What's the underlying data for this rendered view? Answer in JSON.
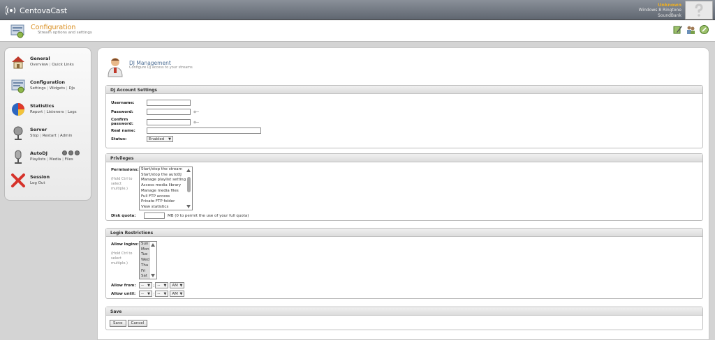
{
  "app": {
    "name": "CentovaCast"
  },
  "user": {
    "name": "Unknown",
    "os": "Windows 8 Ringtone",
    "server": "SoundBank"
  },
  "header": {
    "title": "Configuration",
    "subtitle": "Stream options and settings"
  },
  "sidebar": {
    "sections": [
      {
        "title": "General",
        "links": [
          "Overview",
          "Quick Links"
        ]
      },
      {
        "title": "Configuration",
        "links": [
          "Settings",
          "Widgets",
          "DJs"
        ]
      },
      {
        "title": "Statistics",
        "links": [
          "Report",
          "Listeners",
          "Logs"
        ]
      },
      {
        "title": "Server",
        "links": [
          "Stop",
          "Restart",
          "Admin"
        ]
      },
      {
        "title": "AutoDJ",
        "links": [
          "Playlists",
          "Media",
          "Files"
        ]
      },
      {
        "title": "Session",
        "links": [
          "Log Out"
        ]
      }
    ]
  },
  "page": {
    "title": "DJ Management",
    "subtitle": "Configure DJ access to your streams"
  },
  "account": {
    "legend": "DJ Account Settings",
    "username_label": "Username:",
    "password_label": "Password:",
    "confirm_label": "Confirm password:",
    "realname_label": "Real name:",
    "status_label": "Status:",
    "status_value": "Enabled"
  },
  "privileges": {
    "legend": "Privileges",
    "permissions_label": "Permissions:",
    "hint": "(Hold Ctrl to select multiple.)",
    "options": [
      "Start/stop the stream",
      "Start/stop the autoDJ",
      "Manage playlist settings",
      "Access media library",
      "Manage media files",
      "Full FTP access",
      "Private FTP folder",
      "View statistics"
    ],
    "quota_label": "Disk quota:",
    "quota_note": "MB (0 to permit the use of your full quota)"
  },
  "login": {
    "legend": "Login Restrictions",
    "allow_logins_label": "Allow logins:",
    "hint": "(Hold Ctrl to select multiple.)",
    "days": [
      "Sun",
      "Mon",
      "Tue",
      "Wed",
      "Thu",
      "Fri",
      "Sat"
    ],
    "allow_from_label": "Allow from:",
    "allow_until_label": "Allow until:",
    "hour_placeholder": "--",
    "minute_placeholder": "--",
    "ampm": "AM",
    "colon": ":"
  },
  "save": {
    "legend": "Save",
    "save_label": "Save",
    "cancel_label": "Cancel"
  },
  "colors": {
    "accent": "#d88b1a",
    "title_blue": "#4d6e94",
    "topbar": "#6b7179"
  }
}
